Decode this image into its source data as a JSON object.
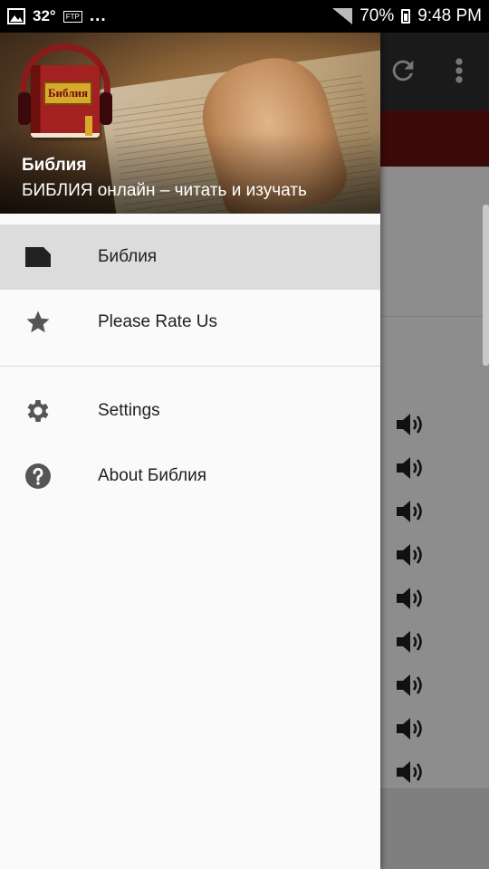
{
  "status_bar": {
    "temperature": "32°",
    "ftp_badge": "FTP",
    "dots": "...",
    "battery": "70%",
    "time": "9:48 PM"
  },
  "drawer": {
    "header": {
      "title": "Библия",
      "subtitle": "БИБЛИЯ онлайн – читать и изучать",
      "logo_text": "Библия"
    },
    "items": [
      {
        "label": "Библия",
        "icon": "book-icon",
        "selected": true
      },
      {
        "label": "Please Rate Us",
        "icon": "star-icon",
        "selected": false
      },
      {
        "label": "Settings",
        "icon": "gear-icon",
        "selected": false
      },
      {
        "label": "About Библия",
        "icon": "help-icon",
        "selected": false
      }
    ]
  },
  "background_app": {
    "toolbar_icons": [
      "refresh-icon",
      "more-vert-icon"
    ],
    "audio_rows": 9
  },
  "colors": {
    "drawer_bg": "#fafafa",
    "selected_bg": "#dcdcdc",
    "icon_gray": "#555555",
    "brand_red": "#a42121"
  }
}
